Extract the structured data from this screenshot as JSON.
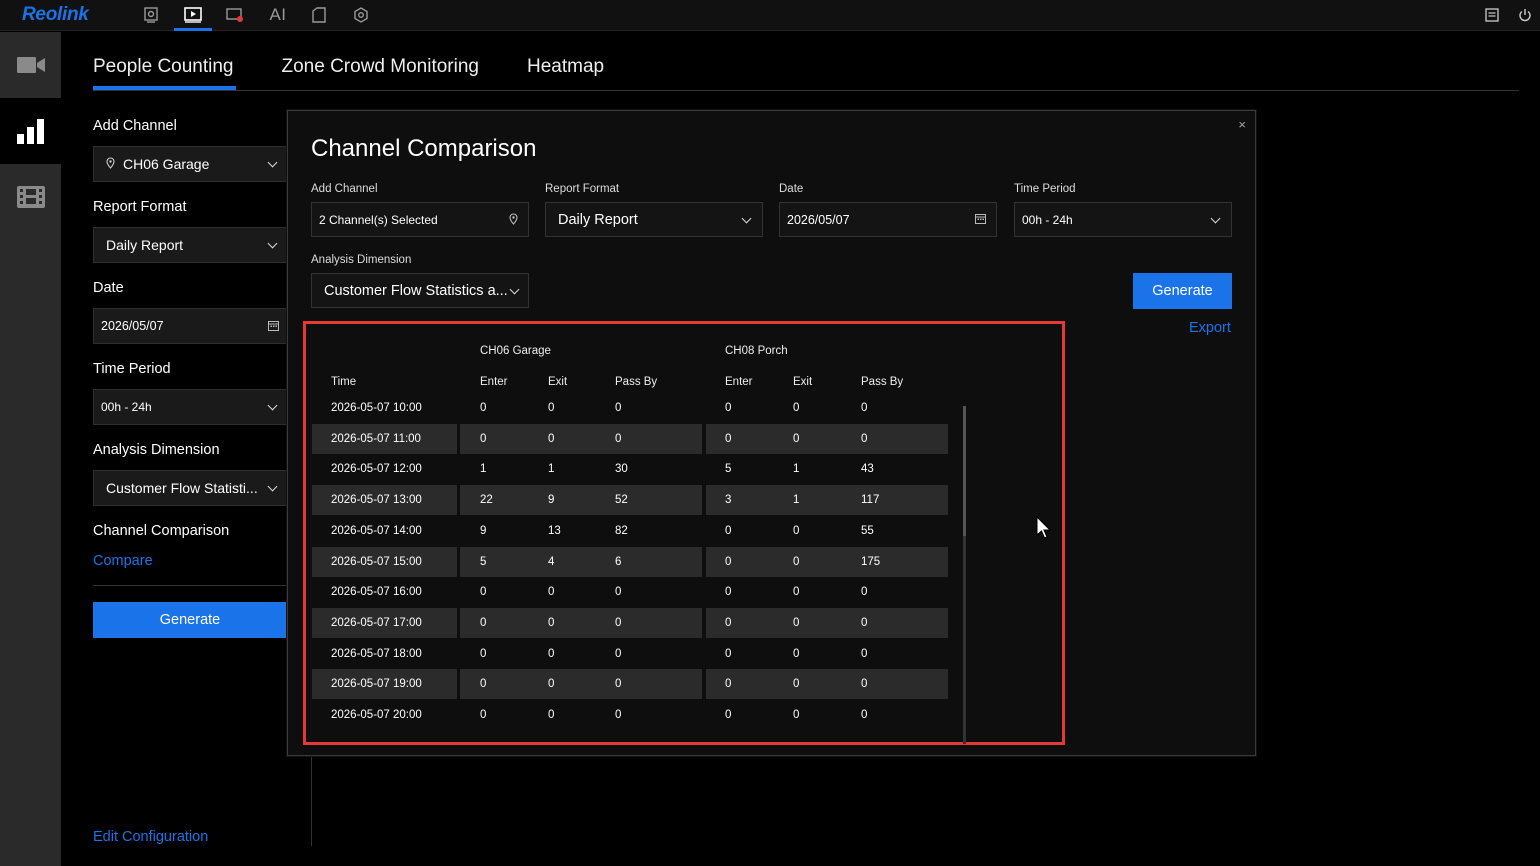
{
  "app": {
    "brand": "Reolink"
  },
  "topnav": {
    "icons": [
      "live-view-icon",
      "playback-icon",
      "alarm-icon",
      "ai-icon",
      "file-icon",
      "settings-icon"
    ],
    "ai_label": "AI",
    "right_icons": [
      "message-icon",
      "power-icon"
    ]
  },
  "rail": {
    "items": [
      "camera-icon",
      "bar-chart-icon",
      "film-icon"
    ]
  },
  "tabs": [
    {
      "label": "People Counting",
      "active": true
    },
    {
      "label": "Zone Crowd Monitoring",
      "active": false
    },
    {
      "label": "Heatmap",
      "active": false
    }
  ],
  "sidebar": {
    "add_channel_label": "Add Channel",
    "add_channel_value": "CH06 Garage",
    "report_format_label": "Report Format",
    "report_format_value": "Daily Report",
    "date_label": "Date",
    "date_value": "2026/05/07",
    "time_period_label": "Time Period",
    "time_period_value": "00h - 24h",
    "analysis_label": "Analysis Dimension",
    "analysis_value": "Customer Flow Statisti...",
    "channel_comparison_label": "Channel Comparison",
    "compare_link": "Compare",
    "generate_button": "Generate",
    "edit_config_link": "Edit Configuration"
  },
  "modal": {
    "title": "Channel Comparison",
    "close": "×",
    "add_channel_label": "Add Channel",
    "add_channel_value": "2 Channel(s) Selected",
    "report_format_label": "Report Format",
    "report_format_value": "Daily Report",
    "date_label": "Date",
    "date_value": "2026/05/07",
    "time_period_label": "Time Period",
    "time_period_value": "00h - 24h",
    "analysis_label": "Analysis Dimension",
    "analysis_value": "Customer Flow Statistics a...",
    "generate_button": "Generate",
    "export_link": "Export",
    "table": {
      "group_headers": [
        "CH06 Garage",
        "CH08 Porch"
      ],
      "columns": [
        "Time",
        "Enter",
        "Exit",
        "Pass By",
        "Enter",
        "Exit",
        "Pass By"
      ],
      "rows": [
        [
          "2026-05-07 10:00",
          "0",
          "0",
          "0",
          "0",
          "0",
          "0"
        ],
        [
          "2026-05-07 11:00",
          "0",
          "0",
          "0",
          "0",
          "0",
          "0"
        ],
        [
          "2026-05-07 12:00",
          "1",
          "1",
          "30",
          "5",
          "1",
          "43"
        ],
        [
          "2026-05-07 13:00",
          "22",
          "9",
          "52",
          "3",
          "1",
          "117"
        ],
        [
          "2026-05-07 14:00",
          "9",
          "13",
          "82",
          "0",
          "0",
          "55"
        ],
        [
          "2026-05-07 15:00",
          "5",
          "4",
          "6",
          "0",
          "0",
          "175"
        ],
        [
          "2026-05-07 16:00",
          "0",
          "0",
          "0",
          "0",
          "0",
          "0"
        ],
        [
          "2026-05-07 17:00",
          "0",
          "0",
          "0",
          "0",
          "0",
          "0"
        ],
        [
          "2026-05-07 18:00",
          "0",
          "0",
          "0",
          "0",
          "0",
          "0"
        ],
        [
          "2026-05-07 19:00",
          "0",
          "0",
          "0",
          "0",
          "0",
          "0"
        ],
        [
          "2026-05-07 20:00",
          "0",
          "0",
          "0",
          "0",
          "0",
          "0"
        ]
      ]
    }
  },
  "colors": {
    "accent": "#1a73e8",
    "highlight_border": "#e53935"
  }
}
